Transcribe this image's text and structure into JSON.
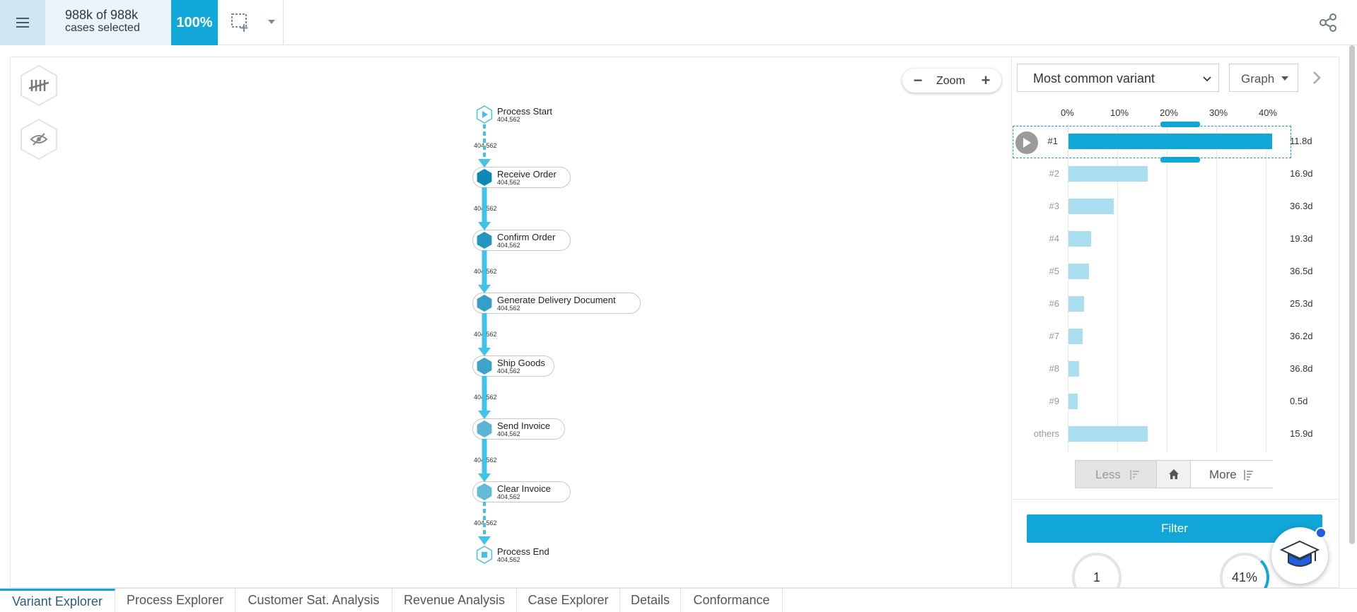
{
  "colors": {
    "accent": "#11a6d8",
    "bar_light": "#a9dfef",
    "node_dark": "#0e88b8",
    "node_light": "#a6e2f2"
  },
  "topbar": {
    "selected_count": "988k of 988k",
    "selected_label": "cases selected",
    "selected_percent": "100%",
    "icons": [
      "menu-icon",
      "add-selection-icon",
      "chevron-down-icon",
      "share-icon"
    ]
  },
  "toolbar": {
    "zoom_label": "Zoom",
    "zoom_minus": "−",
    "zoom_plus": "+"
  },
  "process_map": {
    "nodes": [
      {
        "name": "Process Start",
        "count": "404,562",
        "kind": "start"
      },
      {
        "name": "Receive Order",
        "count": "404,562",
        "kind": "activity",
        "shade": 1.0
      },
      {
        "name": "Confirm Order",
        "count": "404,562",
        "kind": "activity",
        "shade": 0.85
      },
      {
        "name": "Generate Delivery Document",
        "count": "404,562",
        "kind": "activity",
        "shade": 0.75
      },
      {
        "name": "Ship Goods",
        "count": "404,562",
        "kind": "activity",
        "shade": 0.7
      },
      {
        "name": "Send Invoice",
        "count": "404,562",
        "kind": "activity",
        "shade": 0.5
      },
      {
        "name": "Clear Invoice",
        "count": "404,562",
        "kind": "activity",
        "shade": 0.45
      },
      {
        "name": "Process End",
        "count": "404,562",
        "kind": "end"
      }
    ],
    "edges": [
      "404,562",
      "404,562",
      "404,562",
      "404,562",
      "404,562",
      "404,562",
      "404,562"
    ]
  },
  "right_panel": {
    "variant_select": "Most common variant",
    "view_select": "Graph",
    "less_label": "Less",
    "more_label": "More",
    "filter_label": "Filter",
    "stats": [
      "1",
      "41%"
    ]
  },
  "chart_data": {
    "type": "bar",
    "orientation": "horizontal",
    "x_ticks": [
      "0%",
      "10%",
      "20%",
      "30%",
      "40%"
    ],
    "xlim": [
      0,
      50
    ],
    "categories": [
      "#1",
      "#2",
      "#3",
      "#4",
      "#5",
      "#6",
      "#7",
      "#8",
      "#9",
      "others"
    ],
    "values": [
      41.2,
      16.0,
      9.2,
      4.5,
      4.1,
      3.2,
      2.8,
      2.2,
      1.8,
      16.0
    ],
    "durations": [
      "11.8d",
      "16.9d",
      "36.3d",
      "19.3d",
      "36.5d",
      "25.3d",
      "36.2d",
      "36.8d",
      "0.5d",
      "15.9d"
    ],
    "selected_index": 0
  },
  "tabs": [
    {
      "label": "Variant Explorer",
      "active": true
    },
    {
      "label": "Process Explorer",
      "active": false
    },
    {
      "label": "Customer Sat. Analysis",
      "active": false
    },
    {
      "label": "Revenue Analysis",
      "active": false
    },
    {
      "label": "Case Explorer",
      "active": false
    },
    {
      "label": "Details",
      "active": false
    },
    {
      "label": "Conformance",
      "active": false
    }
  ]
}
